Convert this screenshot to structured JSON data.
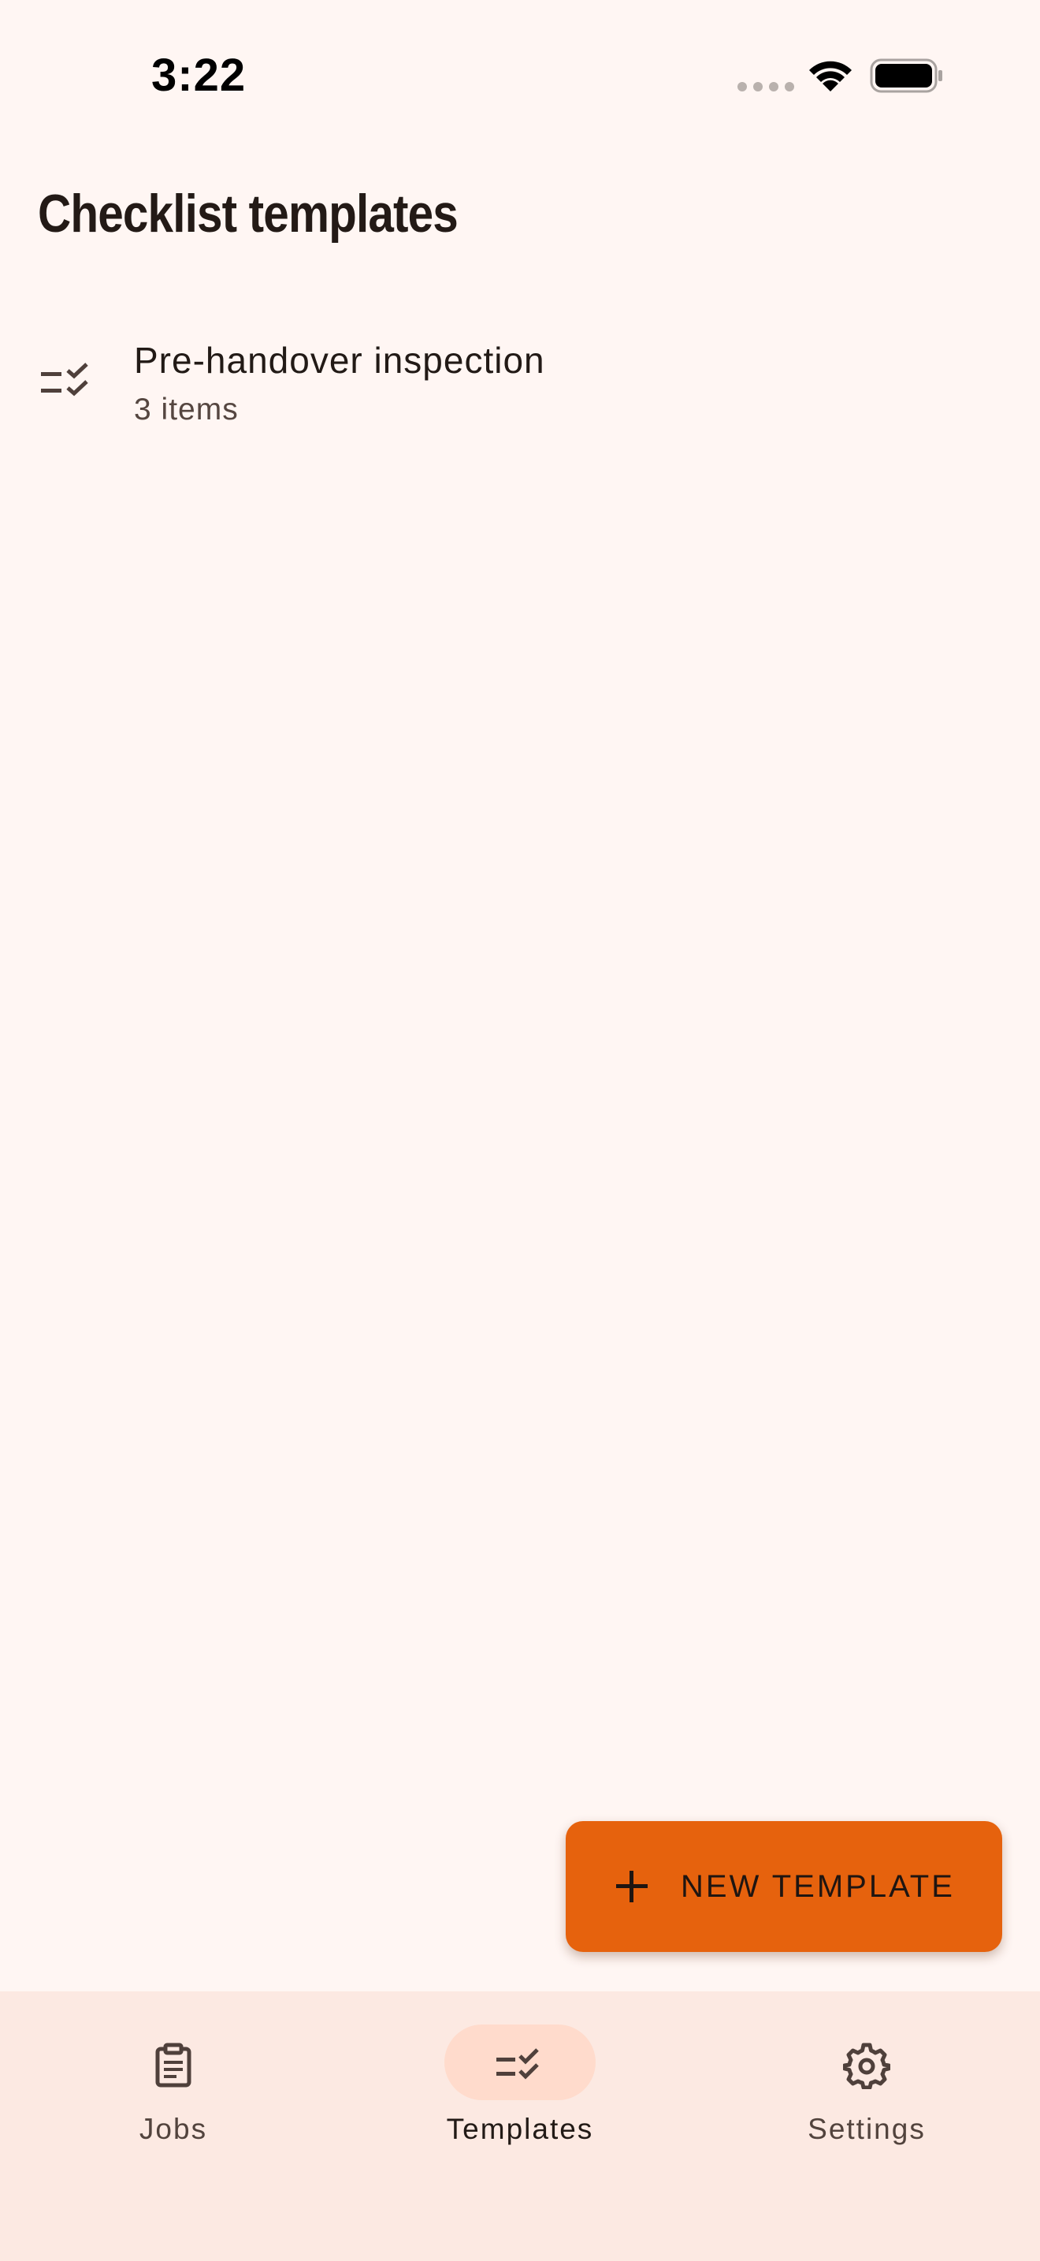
{
  "status_bar": {
    "time": "3:22",
    "icons": [
      "signal-dots-icon",
      "wifi-icon",
      "battery-icon"
    ]
  },
  "header": {
    "title": "Checklist templates"
  },
  "templates": [
    {
      "icon": "checklist-icon",
      "title": "Pre-handover inspection",
      "subtitle": "3 items"
    }
  ],
  "fab": {
    "icon": "plus-icon",
    "label": "NEW TEMPLATE"
  },
  "bottom_nav": {
    "items": [
      {
        "icon": "clipboard-icon",
        "label": "Jobs",
        "active": false
      },
      {
        "icon": "checklist-icon",
        "label": "Templates",
        "active": true
      },
      {
        "icon": "gear-icon",
        "label": "Settings",
        "active": false
      }
    ]
  },
  "colors": {
    "background": "#FFF6F3",
    "accent": "#E6620D",
    "nav_background": "#FCE9E2",
    "active_pill": "#FFDBCC",
    "text_primary": "#221A16",
    "text_secondary": "#554640"
  }
}
